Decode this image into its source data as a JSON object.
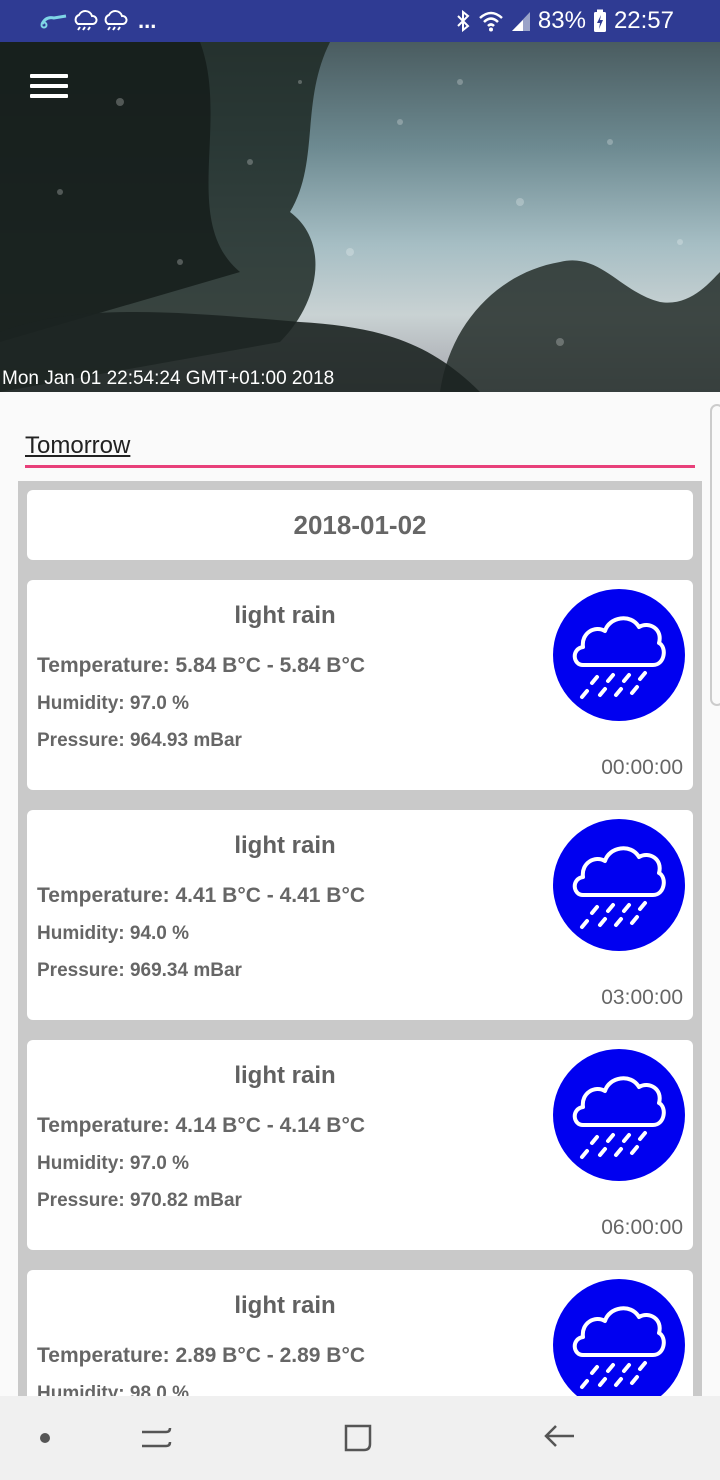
{
  "status_bar": {
    "battery": "83%",
    "time": "22:57",
    "overflow": "..."
  },
  "header": {
    "timestamp": "Mon Jan 01 22:54:24 GMT+01:00 2018"
  },
  "tab": {
    "label": "Tomorrow"
  },
  "date": "2018-01-02",
  "colors": {
    "icon_bg": "#0000f0",
    "tab_underline": "#e8407a",
    "status_bar": "#2f3b93"
  },
  "forecasts": [
    {
      "title": "light rain",
      "temperature": "Temperature: 5.84 B°C - 5.84 B°C",
      "humidity": "Humidity: 97.0 %",
      "pressure": "Pressure: 964.93 mBar",
      "time": "00:00:00",
      "icon": "cloud-rain-icon"
    },
    {
      "title": "light rain",
      "temperature": "Temperature: 4.41 B°C - 4.41 B°C",
      "humidity": "Humidity: 94.0 %",
      "pressure": "Pressure: 969.34 mBar",
      "time": "03:00:00",
      "icon": "cloud-rain-icon"
    },
    {
      "title": "light rain",
      "temperature": "Temperature: 4.14 B°C - 4.14 B°C",
      "humidity": "Humidity: 97.0 %",
      "pressure": "Pressure: 970.82 mBar",
      "time": "06:00:00",
      "icon": "cloud-rain-icon"
    },
    {
      "title": "light rain",
      "temperature": "Temperature: 2.89 B°C - 2.89 B°C",
      "humidity": "Humidity: 98.0 %",
      "pressure": "",
      "time": "",
      "icon": "cloud-rain-icon"
    }
  ]
}
